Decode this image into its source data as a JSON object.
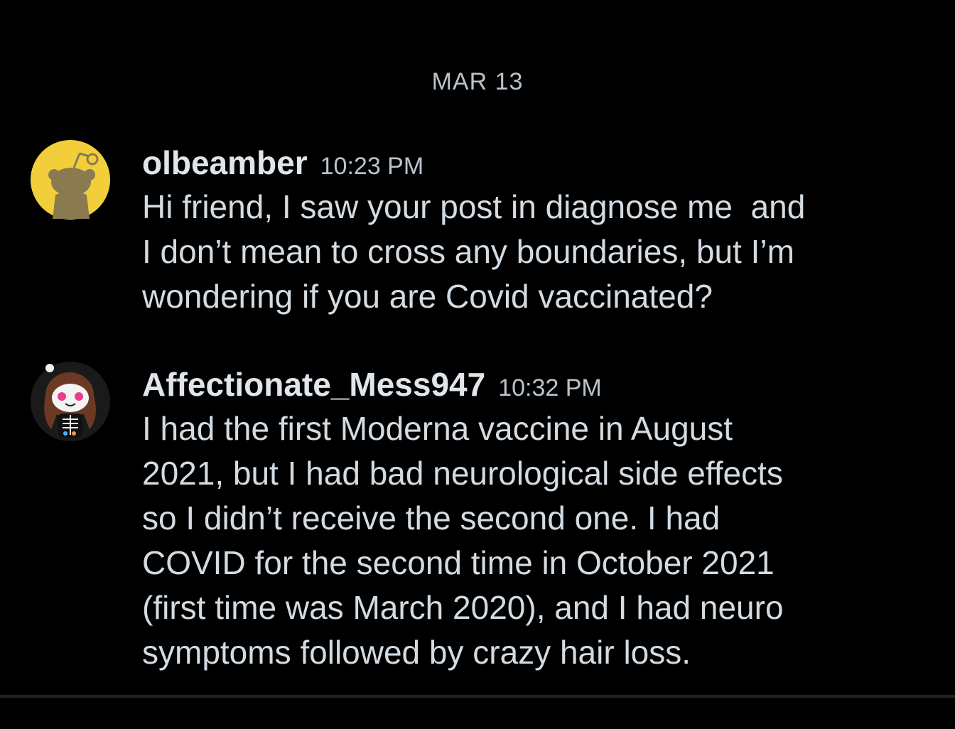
{
  "date_header": "MAR 13",
  "messages": [
    {
      "username": "olbeamber",
      "time": "10:23 PM",
      "avatar_icon": "snoo-avatar-icon",
      "avatar_bg": "#f2cf3a",
      "text": "Hi friend, I saw your post in diagnose me  and\nI don’t mean to cross any boundaries, but I’m\nwondering if you are Covid vaccinated?"
    },
    {
      "username": "Affectionate_Mess947",
      "time": "10:32 PM",
      "avatar_icon": "custom-snoo-avatar-icon",
      "avatar_bg": "#1a1a1a",
      "text": "I had the first Moderna vaccine in August\n2021, but I had bad neurological side effects\nso I didn’t receive the second one. I had\nCOVID for the second time in October 2021\n(first time was March 2020), and I had neuro\nsymptoms followed by crazy hair loss."
    }
  ],
  "colors": {
    "background": "#000000",
    "text": "#d3dbe2",
    "muted": "#b9c3cc"
  }
}
